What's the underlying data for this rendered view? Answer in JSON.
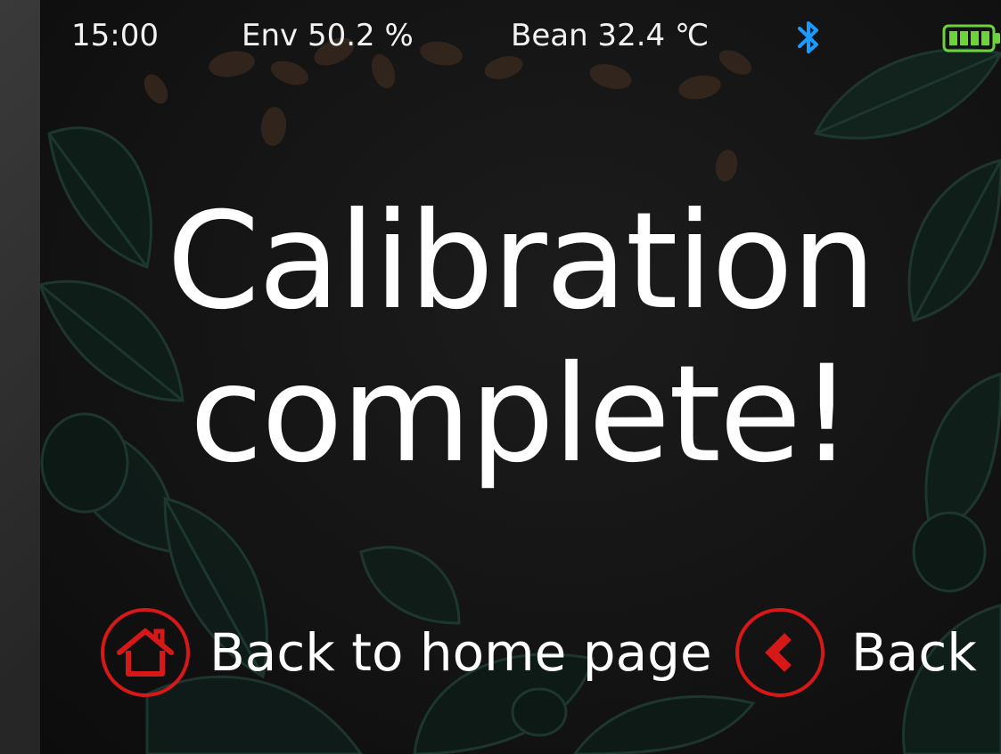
{
  "status_bar": {
    "time": "15:00",
    "env_label": "Env 50.2 %",
    "bean_label": "Bean 32.4 ℃",
    "bluetooth_icon": "bluetooth-icon",
    "battery_icon": "battery-icon",
    "bluetooth_color": "#1a9bff",
    "battery_color": "#6bd43a"
  },
  "message": {
    "line1": "Calibration",
    "line2": "complete!"
  },
  "actions": {
    "home_label": "Back to home page",
    "home_icon": "home-icon",
    "back_label": "Back",
    "back_icon": "chevron-left-icon",
    "accent_color": "#d61818"
  }
}
